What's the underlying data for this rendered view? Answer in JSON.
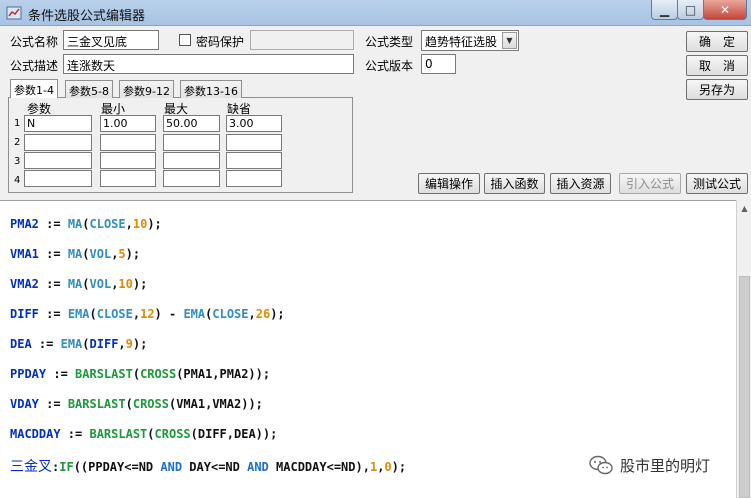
{
  "window": {
    "title": "条件选股公式编辑器",
    "minimize_glyph": "▁",
    "maximize_glyph": "□",
    "close_glyph": "✕"
  },
  "form": {
    "name_label": "公式名称",
    "name_value": "三金叉见底",
    "password_label": "密码保护",
    "password_value": "",
    "type_label": "公式类型",
    "type_value": "趋势特征选股",
    "desc_label": "公式描述",
    "desc_value": "连涨数天",
    "version_label": "公式版本",
    "version_value": "0"
  },
  "buttons": {
    "ok": "确定",
    "cancel": "取消",
    "save_as": "另存为",
    "edit_ops": "编辑操作",
    "insert_func": "插入函数",
    "insert_res": "插入资源",
    "import": "引入公式",
    "test": "测试公式"
  },
  "tabs": [
    "参数1-4",
    "参数5-8",
    "参数9-12",
    "参数13-16"
  ],
  "params": {
    "headers": [
      "参数",
      "最小",
      "最大",
      "缺省"
    ],
    "rows": [
      {
        "n": "1",
        "name": "N",
        "min": "1.00",
        "max": "50.00",
        "def": "3.00"
      },
      {
        "n": "2",
        "name": "",
        "min": "",
        "max": "",
        "def": ""
      },
      {
        "n": "3",
        "name": "",
        "min": "",
        "max": "",
        "def": ""
      },
      {
        "n": "4",
        "name": "",
        "min": "",
        "max": "",
        "def": ""
      }
    ]
  },
  "code": {
    "l1": {
      "var": "PMA2",
      "op": " := ",
      "fn": "MA",
      "p1": "(",
      "a": "CLOSE",
      "c": ",",
      "n": "10",
      "e": ");"
    },
    "l2": {
      "var": "VMA1",
      "op": " := ",
      "fn": "MA",
      "p1": "(",
      "a": "VOL",
      "c": ",",
      "n": "5",
      "e": ");"
    },
    "l3": {
      "var": "VMA2",
      "op": " := ",
      "fn": "MA",
      "p1": "(",
      "a": "VOL",
      "c": ",",
      "n": "10",
      "e": ");"
    },
    "l4": {
      "var": "DIFF",
      "op": " := ",
      "fn": "EMA",
      "p1": "(",
      "a": "CLOSE",
      "c": ",",
      "n": "12",
      "m": ") - ",
      "fn2": "EMA",
      "p2": "(",
      "a2": "CLOSE",
      "c2": ",",
      "n2": "26",
      "e": ");"
    },
    "l5": {
      "var": "DEA",
      "op": " := ",
      "fn": "EMA",
      "p1": "(",
      "a": "DIFF",
      "c": ",",
      "n": "9",
      "e": ");"
    },
    "l6": {
      "var": "PPDAY",
      "op": " := ",
      "fn": "BARSLAST",
      "p1": "(",
      "fn2": "CROSS",
      "args": "(PMA1,PMA2));"
    },
    "l7": {
      "var": "VDAY",
      "op": " := ",
      "fn": "BARSLAST",
      "p1": "(",
      "fn2": "CROSS",
      "args": "(VMA1,VMA2));"
    },
    "l8": {
      "var": "MACDDAY",
      "op": " := ",
      "fn": "BARSLAST",
      "p1": "(",
      "fn2": "CROSS",
      "args": "(DIFF,DEA));"
    },
    "l9": {
      "var": "三金叉",
      "op": ":",
      "fn": "IF",
      "s1": "((PPDAY<=ND ",
      "and1": "AND",
      "s2": " DAY<=ND ",
      "and2": "AND",
      "s3": " MACDDAY<=ND),",
      "n1": "1",
      "c": ",",
      "n2": "0",
      "e": ");"
    }
  },
  "watermark": {
    "text": "股市里的明灯",
    "icon": "wechat-icon"
  },
  "colors": {
    "function": "#2f8ec2",
    "function2": "#1a9a3a",
    "variable": "#0030c0",
    "number": "#e08a00"
  }
}
